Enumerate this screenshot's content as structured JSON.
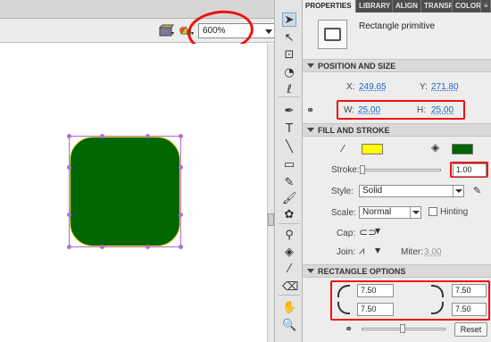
{
  "stage": {
    "zoom_value": "600%"
  },
  "tools": [
    {
      "name": "selection-tool-icon",
      "glyph": "➤"
    },
    {
      "name": "subselection-tool-icon",
      "glyph": "↖"
    },
    {
      "name": "free-transform-tool-icon",
      "glyph": "⊡"
    },
    {
      "name": "3d-rotation-tool-icon",
      "glyph": "◔"
    },
    {
      "name": "lasso-tool-icon",
      "glyph": "ℓ"
    },
    {
      "name": "pen-tool-icon",
      "glyph": "✒"
    },
    {
      "name": "text-tool-icon",
      "glyph": "T"
    },
    {
      "name": "line-tool-icon",
      "glyph": "╲"
    },
    {
      "name": "rectangle-primitive-tool-icon",
      "glyph": "▭"
    },
    {
      "name": "pencil-tool-icon",
      "glyph": "✎"
    },
    {
      "name": "brush-tool-icon",
      "glyph": "🖌"
    },
    {
      "name": "deco-tool-icon",
      "glyph": "✿"
    },
    {
      "name": "bone-tool-icon",
      "glyph": "⚲"
    },
    {
      "name": "paint-bucket-tool-icon",
      "glyph": "◈"
    },
    {
      "name": "eyedropper-tool-icon",
      "glyph": "⁄"
    },
    {
      "name": "eraser-tool-icon",
      "glyph": "⌫"
    },
    {
      "name": "hand-tool-icon",
      "glyph": "✋"
    },
    {
      "name": "zoom-tool-icon",
      "glyph": "🔍"
    }
  ],
  "panel": {
    "tabs": [
      "PROPERTIES",
      "LIBRARY",
      "ALIGN",
      "TRANSF",
      "COLOR"
    ],
    "instance_type": "Rectangle primitive",
    "position_and_size": {
      "title": "POSITION AND SIZE",
      "x_label": "X:",
      "x_value": "249.65",
      "y_label": "Y:",
      "y_value": "271.80",
      "w_label": "W:",
      "w_value": "25.00",
      "h_label": "H:",
      "h_value": "25.00"
    },
    "fill_and_stroke": {
      "title": "FILL AND STROKE",
      "stroke_color": "#ffff00",
      "fill_color": "#006600",
      "stroke_label": "Stroke:",
      "stroke_value": "1.00",
      "style_label": "Style:",
      "style_value": "Solid",
      "scale_label": "Scale:",
      "scale_value": "Normal",
      "hinting_label": "Hinting",
      "cap_label": "Cap:",
      "join_label": "Join:",
      "miter_label": "Miter:",
      "miter_value": "3.00"
    },
    "rectangle_options": {
      "title": "RECTANGLE OPTIONS",
      "top_left": "7.50",
      "top_right": "7.50",
      "bottom_left": "7.50",
      "bottom_right": "7.50",
      "reset_label": "Reset"
    }
  },
  "colors": {
    "highlight": "#ee1111",
    "shape_fill": "#006600",
    "shape_stroke": "#f0e020",
    "selection": "#b36ad6"
  }
}
